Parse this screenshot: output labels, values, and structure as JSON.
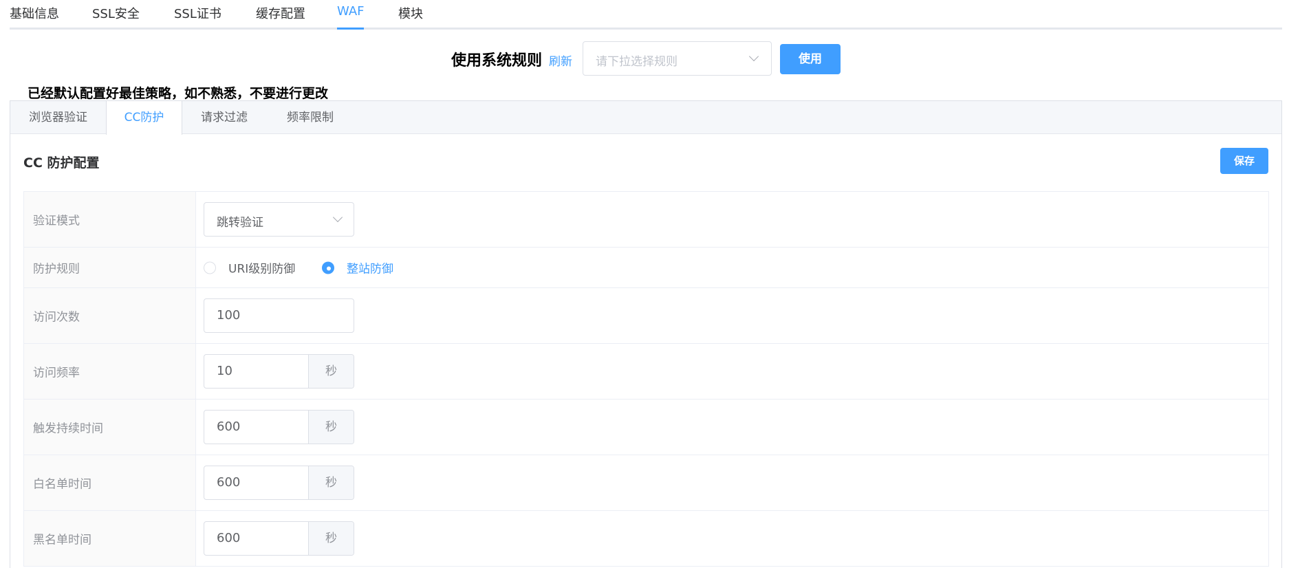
{
  "top_tabs": [
    {
      "label": "基础信息"
    },
    {
      "label": "SSL安全"
    },
    {
      "label": "SSL证书"
    },
    {
      "label": "缓存配置"
    },
    {
      "label": "WAF",
      "active": true
    },
    {
      "label": "模块"
    }
  ],
  "rule": {
    "title": "使用系统规则",
    "refresh": "刷新",
    "placeholder": "请下拉选择规则",
    "apply": "使用"
  },
  "notice": "已经默认配置好最佳策略，如不熟悉，不要进行更改",
  "sub_tabs": [
    {
      "label": "浏览器验证"
    },
    {
      "label": "CC防护",
      "active": true
    },
    {
      "label": "请求过滤"
    },
    {
      "label": "频率限制"
    }
  ],
  "section": {
    "title": "CC 防护配置",
    "save": "保存"
  },
  "form": {
    "verify_mode": {
      "label": "验证模式",
      "value": "跳转验证"
    },
    "protect_rule": {
      "label": "防护规则",
      "options": [
        "URI级别防御",
        "整站防御"
      ],
      "selected": "整站防御"
    },
    "visit_count": {
      "label": "访问次数",
      "value": "100"
    },
    "visit_rate": {
      "label": "访问频率",
      "value": "10",
      "unit": "秒"
    },
    "trigger_duration": {
      "label": "触发持续时间",
      "value": "600",
      "unit": "秒"
    },
    "whitelist_time": {
      "label": "白名单时间",
      "value": "600",
      "unit": "秒"
    },
    "blacklist_time": {
      "label": "黑名单时间",
      "value": "600",
      "unit": "秒"
    }
  },
  "colors": {
    "accent": "#409eff",
    "border": "#dcdfe6",
    "label_bg": "#fafafa"
  }
}
